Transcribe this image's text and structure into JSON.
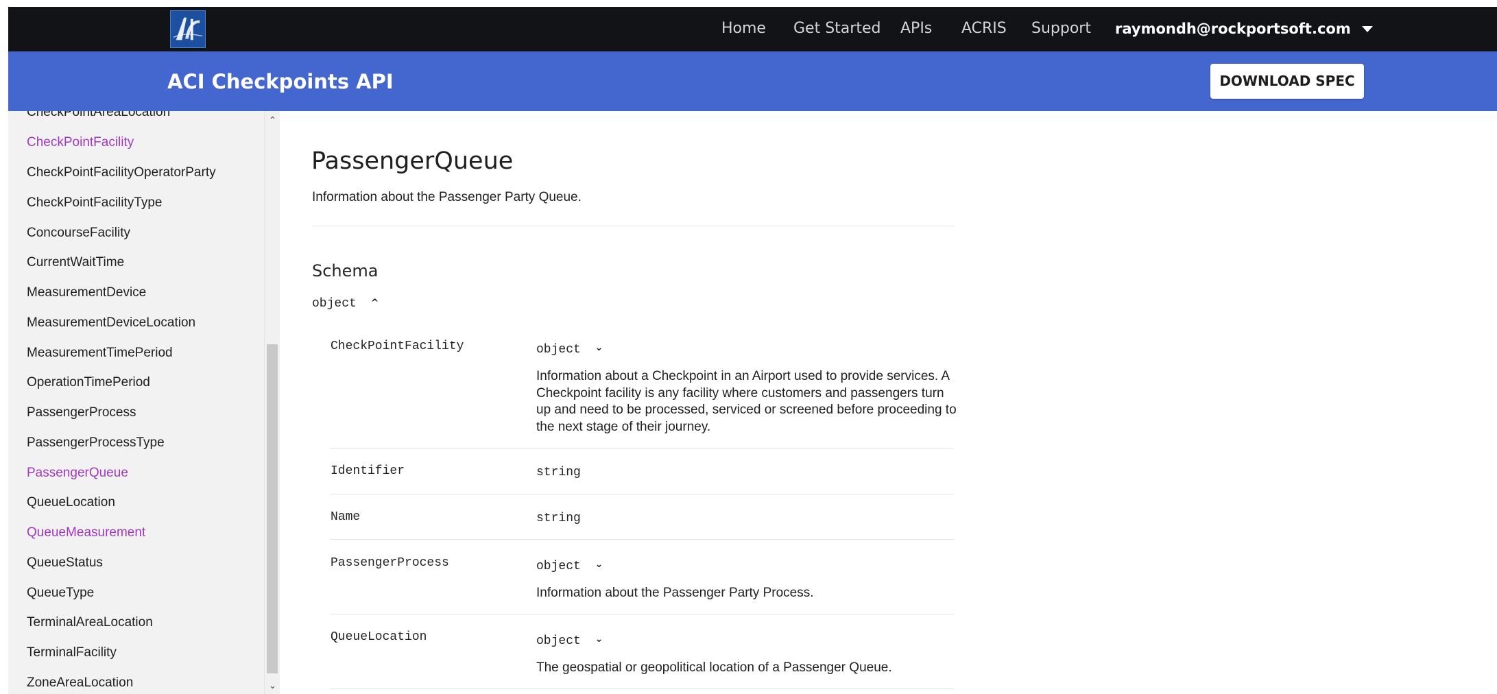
{
  "nav": {
    "links": [
      "Home",
      "Get Started",
      "APIs",
      "ACRIS",
      "Support"
    ],
    "user": "raymondh@rockportsoft.com"
  },
  "header": {
    "api_title": "ACI Checkpoints API",
    "download_label": "DOWNLOAD SPEC"
  },
  "sidebar": {
    "items": [
      {
        "label": "CheckPointAreaLocation",
        "visited": false
      },
      {
        "label": "CheckPointFacility",
        "visited": true
      },
      {
        "label": "CheckPointFacilityOperatorParty",
        "visited": false
      },
      {
        "label": "CheckPointFacilityType",
        "visited": false
      },
      {
        "label": "ConcourseFacility",
        "visited": false
      },
      {
        "label": "CurrentWaitTime",
        "visited": false
      },
      {
        "label": "MeasurementDevice",
        "visited": false
      },
      {
        "label": "MeasurementDeviceLocation",
        "visited": false
      },
      {
        "label": "MeasurementTimePeriod",
        "visited": false
      },
      {
        "label": "OperationTimePeriod",
        "visited": false
      },
      {
        "label": "PassengerProcess",
        "visited": false
      },
      {
        "label": "PassengerProcessType",
        "visited": false
      },
      {
        "label": "PassengerQueue",
        "visited": true
      },
      {
        "label": "QueueLocation",
        "visited": false
      },
      {
        "label": "QueueMeasurement",
        "visited": true
      },
      {
        "label": "QueueStatus",
        "visited": false
      },
      {
        "label": "QueueType",
        "visited": false
      },
      {
        "label": "TerminalAreaLocation",
        "visited": false
      },
      {
        "label": "TerminalFacility",
        "visited": false
      },
      {
        "label": "ZoneAreaLocation",
        "visited": false
      }
    ]
  },
  "main": {
    "title": "PassengerQueue",
    "description": "Information about the Passenger Party Queue.",
    "schema_heading": "Schema",
    "schema_type": "object",
    "properties": [
      {
        "name": "CheckPointFacility",
        "type": "object",
        "description": "Information about a Checkpoint in an Airport used to provide services. A Checkpoint facility is any facility where customers and passengers turn up and need to be processed, serviced or screened before proceeding to the next stage of their journey."
      },
      {
        "name": "Identifier",
        "type": "string"
      },
      {
        "name": "Name",
        "type": "string"
      },
      {
        "name": "PassengerProcess",
        "type": "object",
        "description": "Information about the Passenger Party Process."
      },
      {
        "name": "QueueLocation",
        "type": "object",
        "description": "The geospatial or geopolitical location of a Passenger Queue."
      }
    ]
  },
  "colors": {
    "navbar": "#121317",
    "header": "#4466cf",
    "visited_link": "#a338c0"
  },
  "icons": {
    "logo": "aci-logo-icon",
    "user_menu": "caret-down-icon",
    "expand": "chevron-down-icon",
    "collapse": "chevron-up-icon"
  }
}
